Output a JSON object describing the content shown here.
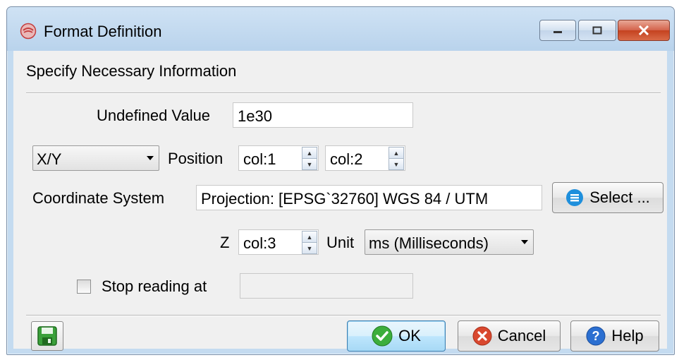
{
  "window": {
    "title": "Format Definition",
    "colors": {
      "titlebar": "#b9d3ec",
      "close": "#c4421f"
    }
  },
  "header": {
    "section_title": "Specify Necessary Information"
  },
  "form": {
    "undefined_value_label": "Undefined Value",
    "undefined_value": "1e30",
    "position_type": "X/Y",
    "position_label": "Position",
    "position_x": "col:1",
    "position_y": "col:2",
    "coord_system_label": "Coordinate System",
    "coord_system_value": "Projection: [EPSG`32760] WGS 84 / UTM",
    "select_button": "Select ...",
    "z_label": "Z",
    "z_value": "col:3",
    "unit_label": "Unit",
    "unit_value": "ms (Milliseconds)",
    "stop_reading_label": "Stop reading at",
    "stop_reading_checked": false,
    "stop_reading_value": ""
  },
  "footer": {
    "ok_label": "OK",
    "cancel_label": "Cancel",
    "help_label": "Help"
  },
  "icons": {
    "app": "app-icon",
    "save": "save-icon",
    "select": "list-icon",
    "ok": "check-icon",
    "cancel": "cancel-icon",
    "help": "help-icon"
  }
}
